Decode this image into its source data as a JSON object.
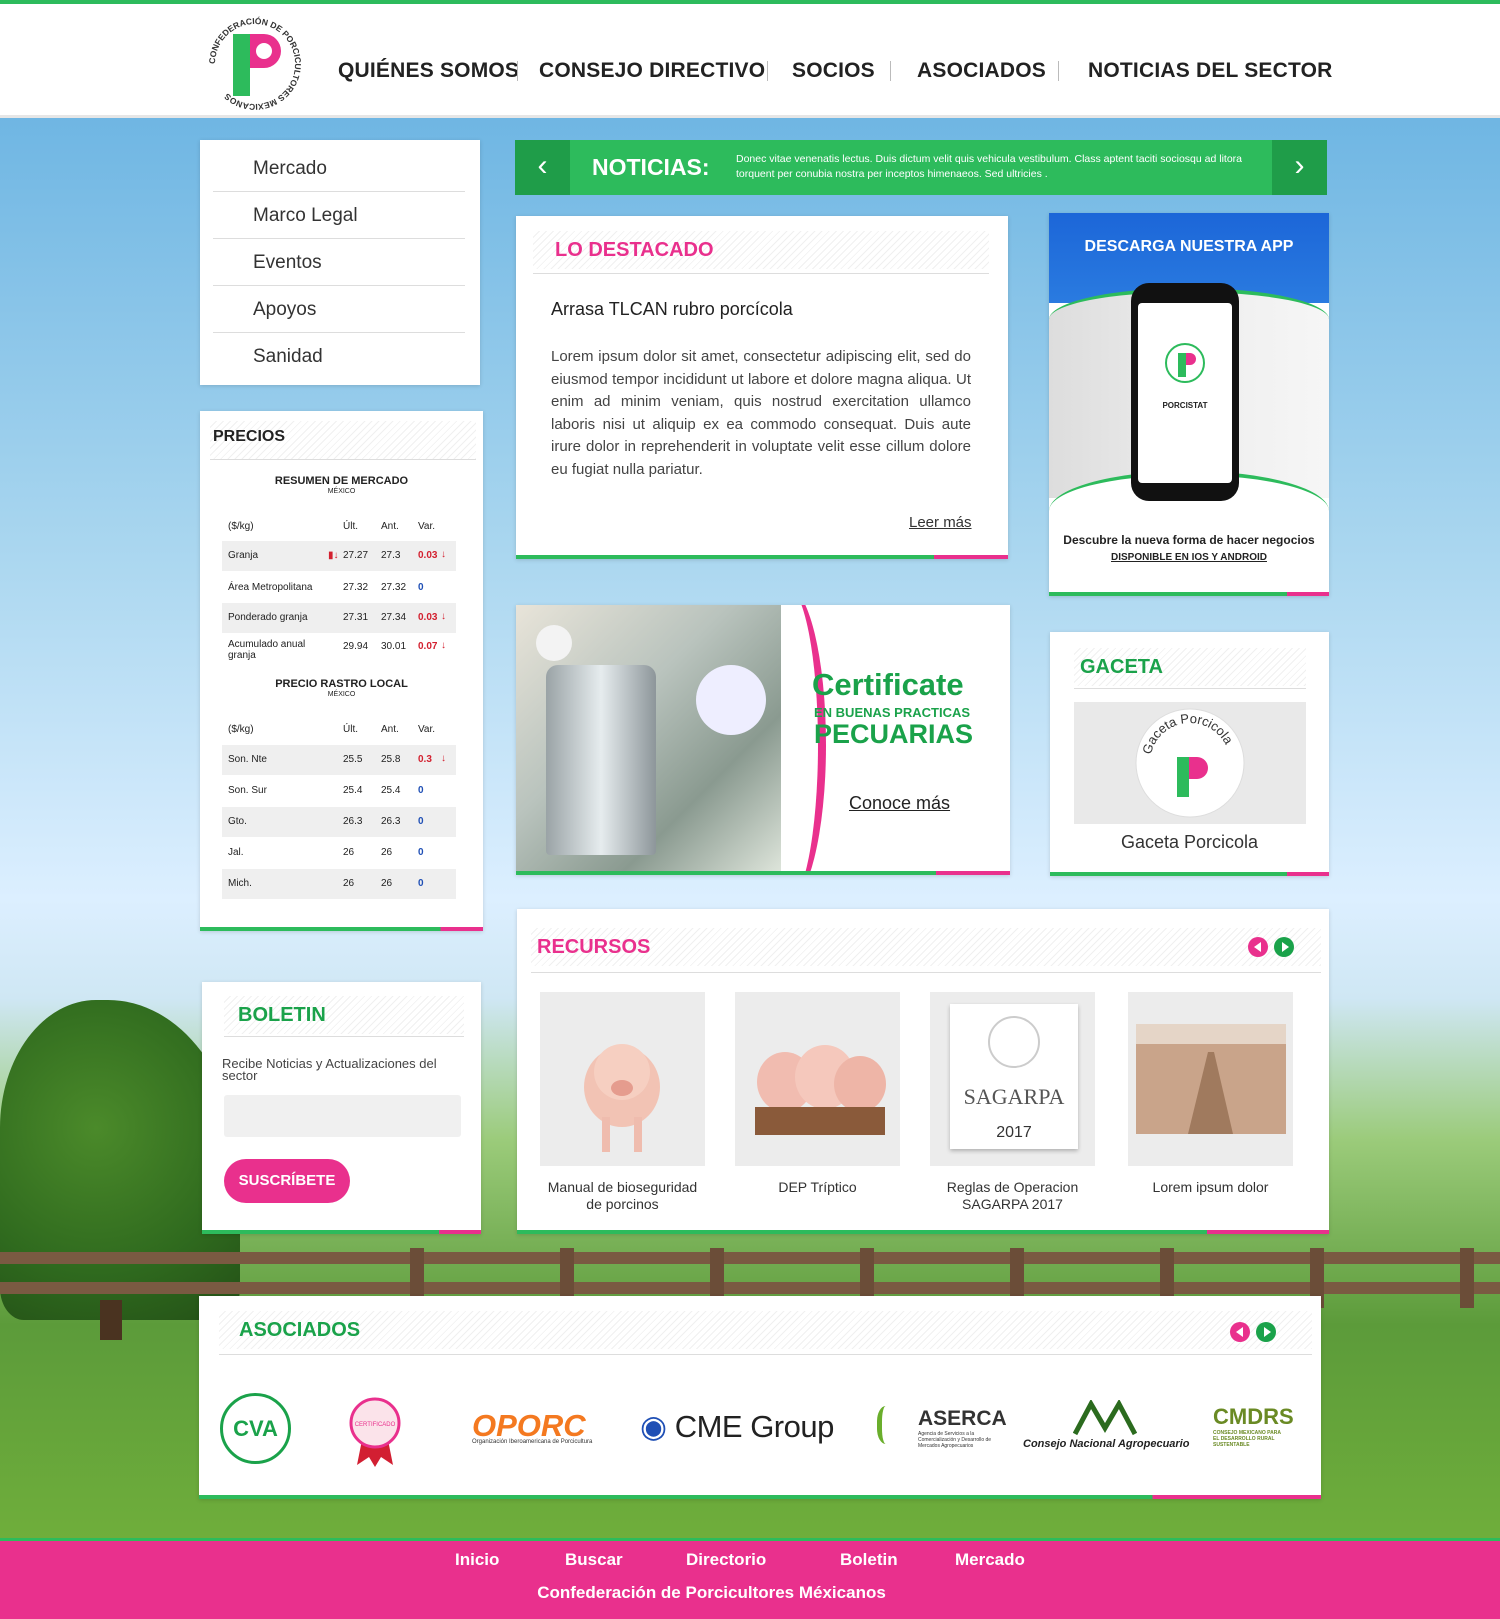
{
  "brand": {
    "logo_text": "CONFEDERACIÓN DE PORCICULTORES MEXICANOS",
    "logo_letter": "P",
    "green": "#2dbb5c",
    "pink": "#e9308d"
  },
  "nav": [
    "QUIÉNES SOMOS",
    "CONSEJO DIRECTIVO",
    "SOCIOS",
    "ASOCIADOS",
    "NOTICIAS DEL SECTOR"
  ],
  "sidemenu": [
    "Mercado",
    "Marco Legal",
    "Eventos",
    "Apoyos",
    "Sanidad"
  ],
  "precios": {
    "title": "PRECIOS",
    "resumen": {
      "title": "RESUMEN DE MERCADO",
      "subtitle": "MÉXICO",
      "headers": [
        "($/kg)",
        "Últ.",
        "Ant.",
        "Var."
      ],
      "rows": [
        {
          "name": "Granja",
          "ult": "27.27",
          "ant": "27.3",
          "var": "0.03",
          "dir": "down"
        },
        {
          "name": "Área Metropolitana",
          "ult": "27.32",
          "ant": "27.32",
          "var": "0",
          "dir": "none"
        },
        {
          "name": "Ponderado granja",
          "ult": "27.31",
          "ant": "27.34",
          "var": "0.03",
          "dir": "down"
        },
        {
          "name": "Acumulado anual granja",
          "ult": "29.94",
          "ant": "30.01",
          "var": "0.07",
          "dir": "down"
        }
      ]
    },
    "rastro": {
      "title": "PRECIO RASTRO LOCAL",
      "subtitle": "MÉXICO",
      "headers": [
        "($/kg)",
        "Últ.",
        "Ant.",
        "Var."
      ],
      "rows": [
        {
          "name": "Son. Nte",
          "ult": "25.5",
          "ant": "25.8",
          "var": "0.3",
          "dir": "down"
        },
        {
          "name": "Son. Sur",
          "ult": "25.4",
          "ant": "25.4",
          "var": "0",
          "dir": "none"
        },
        {
          "name": "Gto.",
          "ult": "26.3",
          "ant": "26.3",
          "var": "0",
          "dir": "none"
        },
        {
          "name": "Jal.",
          "ult": "26",
          "ant": "26",
          "var": "0",
          "dir": "none"
        },
        {
          "name": "Mich.",
          "ult": "26",
          "ant": "26",
          "var": "0",
          "dir": "none"
        }
      ]
    }
  },
  "boletin": {
    "title": "BOLETIN",
    "text": "Recibe Noticias y Actualizaciones del sector",
    "input_placeholder": "",
    "button": "SUSCRÍBETE"
  },
  "ticker": {
    "label": "NOTICIAS:",
    "text": "Donec vitae venenatis lectus. Duis dictum velit quis vehicula vestibulum. Class aptent taciti sociosqu ad litora torquent per conubia nostra per inceptos himenaeos. Sed ultricies ."
  },
  "destacado": {
    "title": "LO DESTACADO",
    "headline": "Arrasa TLCAN rubro porcícola",
    "body": "Lorem ipsum dolor sit amet, consectetur adipiscing elit, sed do eiusmod tempor incididunt ut labore et dolore magna aliqua. Ut enim ad minim veniam, quis nostrud exercitation ullamco laboris nisi ut aliquip ex ea commodo consequat. Duis aute irure dolor in reprehenderit in voluptate velit esse cillum dolore eu fugiat nulla pariatur.",
    "link": "Leer más"
  },
  "app": {
    "title": "DESCARGA NUESTRA APP",
    "app_name": "PORCISTAT",
    "tagline": "Descubre la nueva forma de hacer negocios",
    "link": "DISPONIBLE EN IOS Y ANDROID"
  },
  "certificate": {
    "line1": "Certificate",
    "line2": "EN BUENAS PRACTICAS",
    "line3": "PECUARIAS",
    "link": "Conoce más"
  },
  "gaceta": {
    "title": "GACETA",
    "badge_text": "Gaceta Porcicola",
    "caption": "Gaceta Porcicola"
  },
  "recursos": {
    "title": "RECURSOS",
    "items": [
      {
        "label": "Manual de bioseguridad de porcinos"
      },
      {
        "label": "DEP Tríptico"
      },
      {
        "label": "Reglas de Operacion SAGARPA 2017",
        "image_text": "SAGARPA",
        "image_year": "2017"
      },
      {
        "label": "Lorem ipsum dolor"
      }
    ]
  },
  "asociados": {
    "title": "ASOCIADOS",
    "logos": [
      "CVA",
      "CERTIFICADO",
      "OPORC",
      "CME Group",
      "ASERCA",
      "Consejo Nacional Agropecuario",
      "CMDRS"
    ],
    "opor_sub": "Organización Iberoamericana de Porcicultura",
    "aserca_sub": "Agencia de Servicios a la Comercialización y Desarrollo de Mercados Agropecuarios",
    "cmdrs_sub": "CONSEJO MEXICANO PARA EL DESARROLLO RURAL SUSTENTABLE"
  },
  "footer": {
    "links": [
      "Inicio",
      "Buscar",
      "Directorio",
      "Boletin",
      "Mercado"
    ],
    "org": "Confederación de Porcicultores Méxicanos"
  }
}
